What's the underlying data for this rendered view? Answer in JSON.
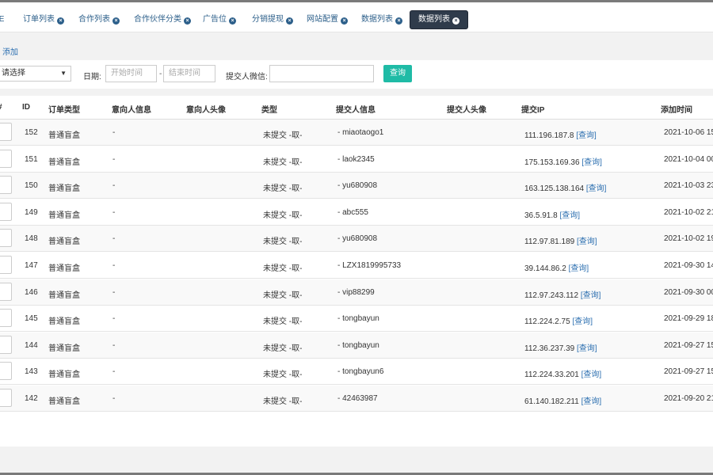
{
  "tabs": [
    {
      "label": "IE",
      "closable": false
    },
    {
      "label": "订单列表",
      "closable": true
    },
    {
      "label": "合作列表",
      "closable": true
    },
    {
      "label": "合作伙伴分类",
      "closable": true
    },
    {
      "label": "广告位",
      "closable": true
    },
    {
      "label": "分销提现",
      "closable": true
    },
    {
      "label": "网站配置",
      "closable": true
    },
    {
      "label": "数据列表",
      "closable": true
    },
    {
      "label": "数据列表",
      "closable": true,
      "active": true
    }
  ],
  "toolbar": {
    "add_label": "添加"
  },
  "filters": {
    "select_value": "请选择",
    "date_label": "日期:",
    "start_placeholder": "开始时间",
    "date_separator": "-",
    "end_placeholder": "结束时间",
    "wechat_label": "提交人微信:",
    "wechat_value": "",
    "query_button": "查询"
  },
  "table": {
    "columns": [
      "ID",
      "订单类型",
      "意向人信息",
      "意向人头像",
      "类型",
      "提交人信息",
      "提交人头像",
      "提交IP",
      "添加时间"
    ],
    "first_column_partial": "#",
    "query_link": "[查询]",
    "rows": [
      {
        "id": "152",
        "order_type": "普通盲盒",
        "intent_info": "-",
        "type": "未提交 -取-",
        "submitter": "- miaotaogo1",
        "ip": "111.196.187.8",
        "time": "2021-10-06 15"
      },
      {
        "id": "151",
        "order_type": "普通盲盒",
        "intent_info": "-",
        "type": "未提交 -取-",
        "submitter": "- laok2345",
        "ip": "175.153.169.36",
        "time": "2021-10-04 00"
      },
      {
        "id": "150",
        "order_type": "普通盲盒",
        "intent_info": "-",
        "type": "未提交 -取-",
        "submitter": "- yu680908",
        "ip": "163.125.138.164",
        "time": "2021-10-03 23"
      },
      {
        "id": "149",
        "order_type": "普通盲盒",
        "intent_info": "-",
        "type": "未提交 -取-",
        "submitter": "- abc555",
        "ip": "36.5.91.8",
        "time": "2021-10-02 21"
      },
      {
        "id": "148",
        "order_type": "普通盲盒",
        "intent_info": "-",
        "type": "未提交 -取-",
        "submitter": "- yu680908",
        "ip": "112.97.81.189",
        "time": "2021-10-02 19"
      },
      {
        "id": "147",
        "order_type": "普通盲盒",
        "intent_info": "-",
        "type": "未提交 -取-",
        "submitter": "- LZX1819995733",
        "ip": "39.144.86.2",
        "time": "2021-09-30 14"
      },
      {
        "id": "146",
        "order_type": "普通盲盒",
        "intent_info": "-",
        "type": "未提交 -取-",
        "submitter": "- vip88299",
        "ip": "112.97.243.112",
        "time": "2021-09-30 00"
      },
      {
        "id": "145",
        "order_type": "普通盲盒",
        "intent_info": "-",
        "type": "未提交 -取-",
        "submitter": "- tongbayun",
        "ip": "112.224.2.75",
        "time": "2021-09-29 18"
      },
      {
        "id": "144",
        "order_type": "普通盲盒",
        "intent_info": "-",
        "type": "未提交 -取-",
        "submitter": "- tongbayun",
        "ip": "112.36.237.39",
        "time": "2021-09-27 15"
      },
      {
        "id": "143",
        "order_type": "普通盲盒",
        "intent_info": "-",
        "type": "未提交 -取-",
        "submitter": "- tongbayun6",
        "ip": "112.224.33.201",
        "time": "2021-09-27 15"
      },
      {
        "id": "142",
        "order_type": "普通盲盒",
        "intent_info": "-",
        "type": "未提交 -取-",
        "submitter": "- 42463987",
        "ip": "61.140.182.211",
        "time": "2021-09-20 21"
      }
    ]
  }
}
